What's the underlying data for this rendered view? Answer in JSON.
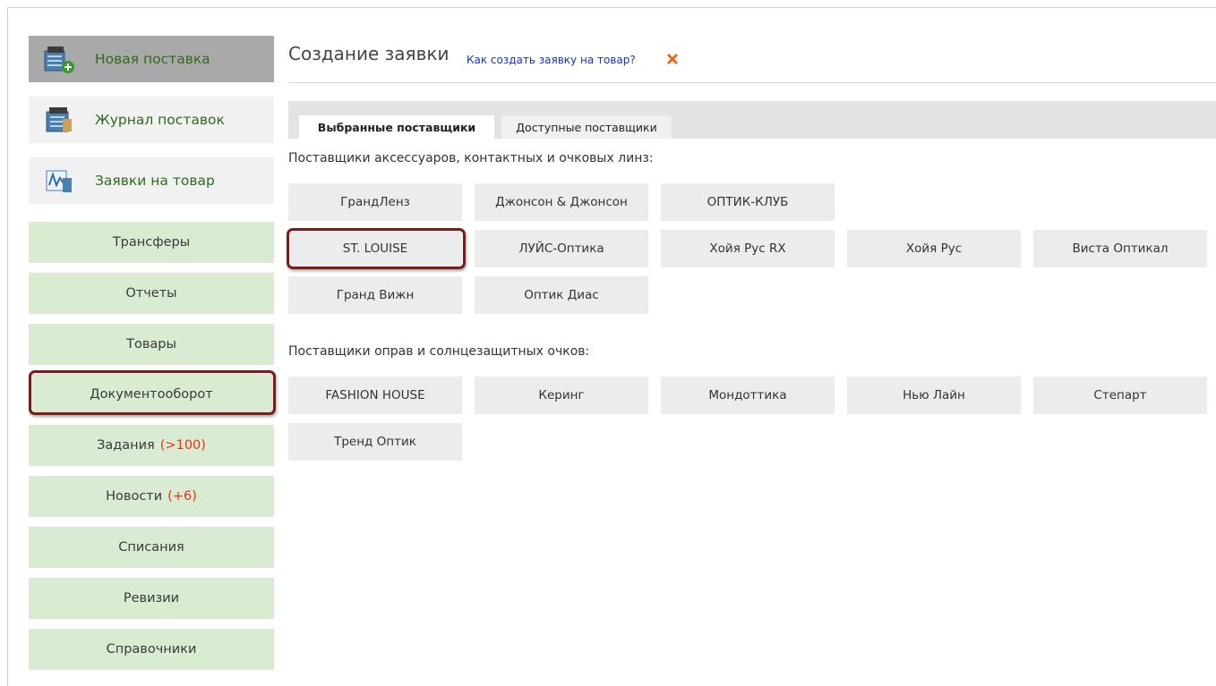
{
  "sidebar": {
    "top": [
      {
        "label": "Новая поставка",
        "icon": "new-delivery-icon"
      },
      {
        "label": "Журнал поставок",
        "icon": "delivery-journal-icon"
      },
      {
        "label": "Заявки на товар",
        "icon": "product-requests-icon"
      }
    ],
    "items": [
      {
        "label": "Трансферы"
      },
      {
        "label": "Отчеты"
      },
      {
        "label": "Товары"
      },
      {
        "label": "Документооборот"
      },
      {
        "label": "Задания",
        "count": "(>100)"
      },
      {
        "label": "Новости",
        "count": "(+6)"
      },
      {
        "label": "Списания"
      },
      {
        "label": "Ревизии"
      },
      {
        "label": "Справочники"
      }
    ]
  },
  "main": {
    "title": "Создание заявки",
    "help_link": "Как создать заявку на товар?",
    "tabs": [
      {
        "label": "Выбранные поставщики",
        "active": true
      },
      {
        "label": "Доступные поставщики",
        "active": false
      }
    ],
    "lens_section": {
      "label": "Поставщики аксессуаров, контактных и очковых линз:",
      "suppliers": [
        "ГрандЛенз",
        "Джонсон & Джонсон",
        "ОПТИК-КЛУБ",
        "ST. LOUISE",
        "ЛУЙС-Оптика",
        "Хойя Рус RX",
        "Хойя Рус",
        "Виста Оптикал",
        "Гранд Вижн",
        "Оптик Диас"
      ]
    },
    "frames_section": {
      "label": "Поставщики оправ и солнцезащитных очков:",
      "suppliers": [
        "FASHION HOUSE",
        "Керинг",
        "Мондоттика",
        "Нью Лайн",
        "Степарт",
        "Тренд Оптик"
      ]
    }
  },
  "colors": {
    "sidebar_green": "#d9ecd2",
    "highlight": "#7a1c1c",
    "count_red": "#e0301e",
    "link_blue": "#1a2fd4"
  }
}
